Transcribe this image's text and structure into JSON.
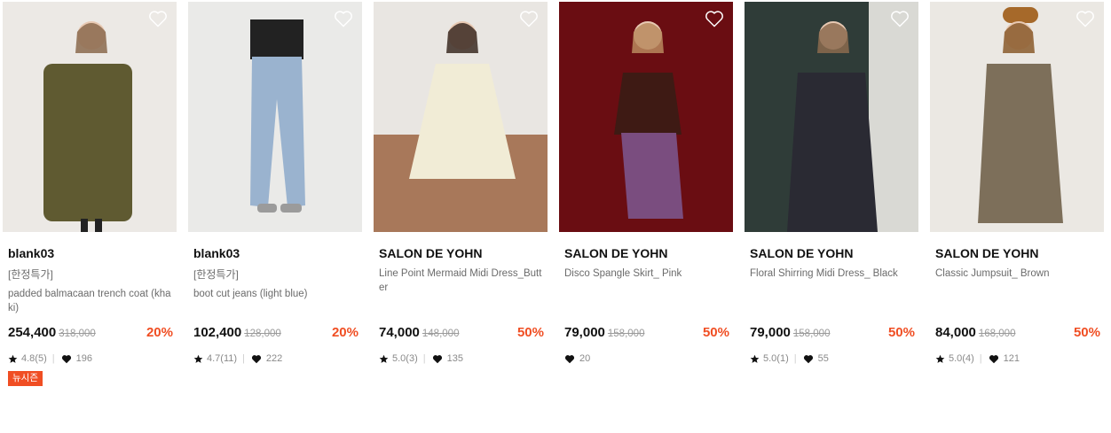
{
  "products": [
    {
      "brand": "blank03",
      "tag": "[한정특가]",
      "name": "padded balmacaan trench coat (khaki)",
      "price": "254,400",
      "original_price": "318,000",
      "discount": "20%",
      "rating": "4.8(5)",
      "likes": "196",
      "badge": "뉴시즌",
      "bg": "#ece9e5",
      "garment": "#5f5a31"
    },
    {
      "brand": "blank03",
      "tag": "[한정특가]",
      "name": "boot cut jeans (light blue)",
      "price": "102,400",
      "original_price": "128,000",
      "discount": "20%",
      "rating": "4.7(11)",
      "likes": "222",
      "bg": "#eaeae8",
      "garment": "#9ab3cf"
    },
    {
      "brand": "SALON DE YOHN",
      "name": "Line Point Mermaid Midi Dress_Butter",
      "price": "74,000",
      "original_price": "148,000",
      "discount": "50%",
      "rating": "5.0(3)",
      "likes": "135",
      "bg": "#e9e6e2",
      "garment": "#f1ecd6"
    },
    {
      "brand": "SALON DE YOHN",
      "name": "Disco Spangle Skirt_ Pink",
      "price": "79,000",
      "original_price": "158,000",
      "discount": "50%",
      "likes": "20",
      "bg": "#6a0d12",
      "garment": "#3e1a14"
    },
    {
      "brand": "SALON DE YOHN",
      "name": "Floral Shirring Midi Dress_ Black",
      "price": "79,000",
      "original_price": "158,000",
      "discount": "50%",
      "rating": "5.0(1)",
      "likes": "55",
      "bg": "#2f3c38",
      "garment": "#2a2a33"
    },
    {
      "brand": "SALON DE YOHN",
      "name": "Classic Jumpsuit_ Brown",
      "price": "84,000",
      "original_price": "168,000",
      "discount": "50%",
      "rating": "5.0(4)",
      "likes": "121",
      "bg": "#ebe8e3",
      "garment": "#7d6f5a"
    }
  ],
  "colors": {
    "accent": "#f04e23",
    "muted": "#6b6b6b",
    "strike": "#9a9a9a"
  },
  "icons": {
    "wishlist": "heart-outline-icon",
    "rating": "star-icon",
    "likes": "heart-icon"
  }
}
